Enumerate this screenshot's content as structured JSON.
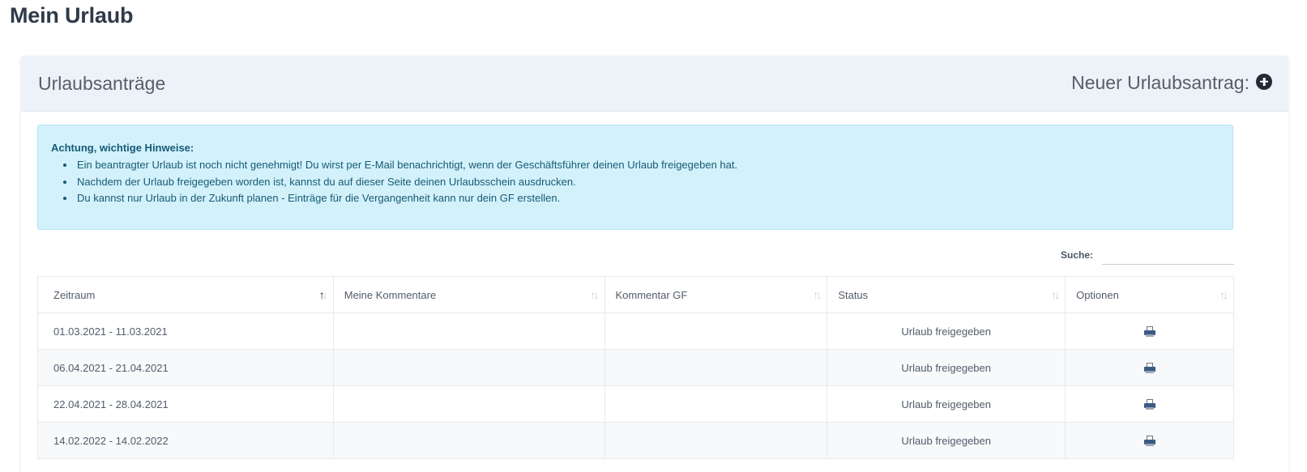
{
  "page": {
    "title": "Mein Urlaub"
  },
  "card": {
    "title": "Urlaubsanträge",
    "new_request_label": "Neuer Urlaubsantrag:",
    "new_request_icon": "plus-circle-icon"
  },
  "alert": {
    "title": "Achtung, wichtige Hinweise:",
    "items": [
      "Ein beantragter Urlaub ist noch nicht genehmigt! Du wirst per E-Mail benachrichtigt, wenn der Geschäftsführer deinen Urlaub freigegeben hat.",
      "Nachdem der Urlaub freigegeben worden ist, kannst du auf dieser Seite deinen Urlaubsschein ausdrucken.",
      "Du kannst nur Urlaub in der Zukunft planen - Einträge für die Vergangenheit kann nur dein GF erstellen."
    ]
  },
  "search": {
    "label": "Suche:",
    "value": ""
  },
  "table": {
    "columns": [
      "Zeitraum",
      "Meine Kommentare",
      "Kommentar GF",
      "Status",
      "Optionen"
    ],
    "sorted_column": "Zeitraum",
    "rows": [
      {
        "zeitraum": "01.03.2021 - 11.03.2021",
        "kommentare": "",
        "kommentar_gf": "",
        "status": "Urlaub freigegeben",
        "option_icon": "print-icon"
      },
      {
        "zeitraum": "06.04.2021 - 21.04.2021",
        "kommentare": "",
        "kommentar_gf": "",
        "status": "Urlaub freigegeben",
        "option_icon": "print-icon"
      },
      {
        "zeitraum": "22.04.2021 - 28.04.2021",
        "kommentare": "",
        "kommentar_gf": "",
        "status": "Urlaub freigegeben",
        "option_icon": "print-icon"
      },
      {
        "zeitraum": "14.02.2022 - 14.02.2022",
        "kommentare": "",
        "kommentar_gf": "",
        "status": "Urlaub freigegeben",
        "option_icon": "print-icon"
      }
    ]
  }
}
